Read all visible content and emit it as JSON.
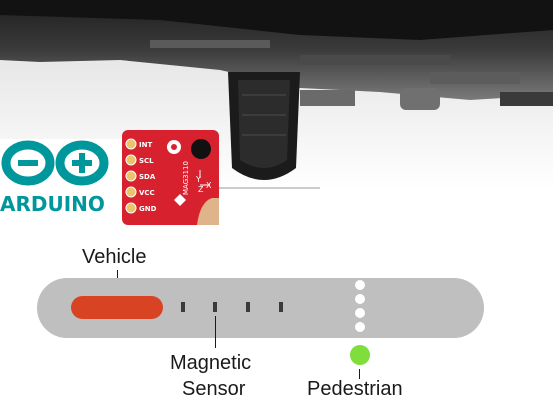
{
  "logo": {
    "word": "ARDUINO",
    "color": "#00979c"
  },
  "sensor_board": {
    "pins": [
      "INT",
      "SCL",
      "SDA",
      "VCC",
      "GND"
    ],
    "chip_text": "MAG3110",
    "axis_labels": [
      "X",
      "Y",
      "Z"
    ],
    "color": "#d8212f"
  },
  "diagram": {
    "vehicle_label": "Vehicle",
    "sensor_label_line1": "Magnetic",
    "sensor_label_line2": "Sensor",
    "pedestrian_label": "Pedestrian",
    "colors": {
      "road": "#bfbfbf",
      "vehicle": "#d84324",
      "sensor": "#3a3a3a",
      "crossing": "#ffffff",
      "pedestrian": "#7fdd3c"
    }
  }
}
